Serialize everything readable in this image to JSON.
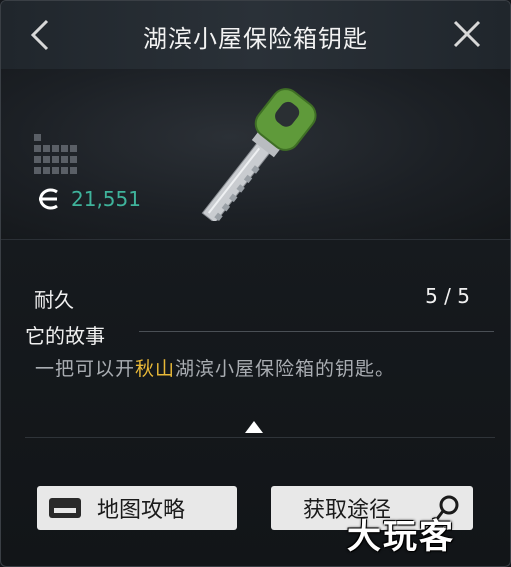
{
  "header": {
    "title": "湖滨小屋保险箱钥匙"
  },
  "item": {
    "price": "21,551",
    "rarity_icon": "grid-icon",
    "currency_icon": "currency-icon"
  },
  "stats": {
    "durability_label": "耐久",
    "durability_value": "5 / 5"
  },
  "story": {
    "header": "它的故事",
    "text_part1": "一把可以开",
    "text_highlight": "秋山",
    "text_part2": "湖滨小屋保险箱的钥匙。"
  },
  "buttons": {
    "map_label": "地图攻略",
    "obtain_label": "获取途径"
  },
  "watermark": "大玩客",
  "colors": {
    "price": "#3fb39b",
    "highlight": "#e8b838",
    "key_green": "#5f9a3a"
  }
}
